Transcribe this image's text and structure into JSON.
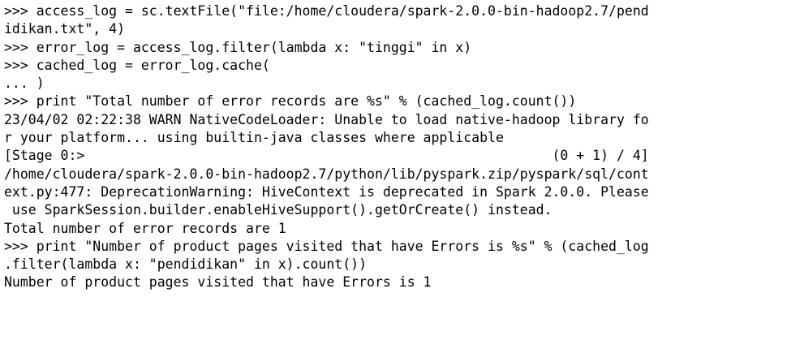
{
  "terminal": {
    "lines": [
      ">>> access_log = sc.textFile(\"file:/home/cloudera/spark-2.0.0-bin-hadoop2.7/pend",
      "idikan.txt\", 4)",
      ">>> error_log = access_log.filter(lambda x: \"tinggi\" in x)",
      ">>> cached_log = error_log.cache(",
      "... )",
      ">>> print \"Total number of error records are %s\" % (cached_log.count())",
      "23/04/02 02:22:38 WARN NativeCodeLoader: Unable to load native-hadoop library fo",
      "r your platform... using builtin-java classes where applicable",
      "[Stage 0:>                                                          (0 + 1) / 4]",
      "/home/cloudera/spark-2.0.0-bin-hadoop2.7/python/lib/pyspark.zip/pyspark/sql/cont",
      "ext.py:477: DeprecationWarning: HiveContext is deprecated in Spark 2.0.0. Please",
      " use SparkSession.builder.enableHiveSupport().getOrCreate() instead.",
      "Total number of error records are 1",
      ">>> print \"Number of product pages visited that have Errors is %s\" % (cached_log",
      ".filter(lambda x: \"pendidikan\" in x).count())",
      "Number of product pages visited that have Errors is 1"
    ]
  }
}
